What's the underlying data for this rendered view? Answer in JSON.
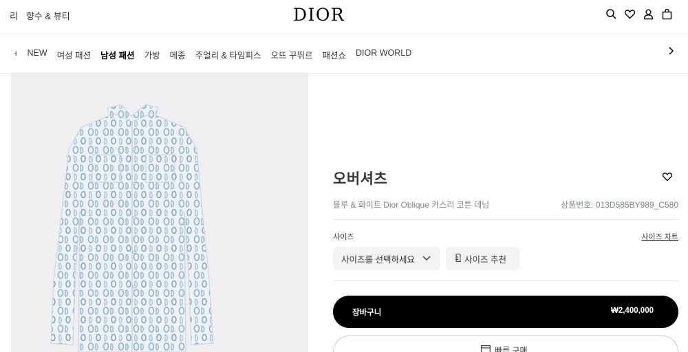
{
  "header": {
    "left_links": [
      "리",
      "향수 & 뷰티"
    ],
    "logo": "DIOR",
    "icons": [
      "search-icon",
      "heart-icon",
      "user-icon",
      "bag-icon"
    ]
  },
  "nav": {
    "items": [
      "NEW",
      "여성 패션",
      "남성 패션",
      "가방",
      "메종",
      "주얼리 & 타임피스",
      "오뜨 꾸뛰르",
      "패션쇼",
      "DIOR WORLD"
    ],
    "partial_prefix": "ᅥ",
    "active": "남성 패션"
  },
  "product": {
    "title": "오버셔츠",
    "subtitle": "블루 & 화이트 Dior Oblique 카스리 코튼 데님",
    "sku": "상품번호: 013D585BY989_C580",
    "size_label": "사이즈",
    "size_chart_link": "사이즈 차트",
    "size_select_placeholder": "사이즈를 선택하세요",
    "size_recommend_label": "사이즈 추천",
    "add_to_cart_label": "장바구니",
    "price": "₩2,400,000",
    "quick_buy_label": "빠른 구매"
  },
  "colors": {
    "accent": "#000000",
    "text": "#33383c",
    "muted": "#7b8487",
    "image_bg": "#efeff1",
    "shirt_base": "#eef2f6",
    "shirt_pattern": "#8fb0cc"
  }
}
